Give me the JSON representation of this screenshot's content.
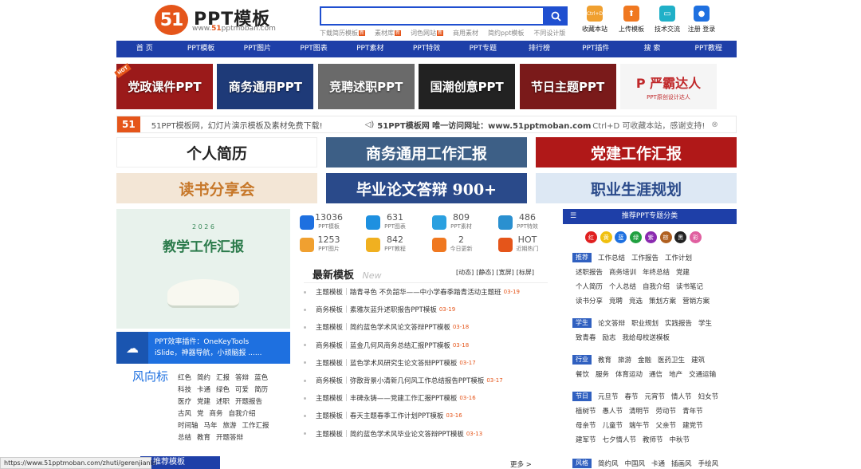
{
  "header": {
    "logo_mark": "51",
    "logo_text": "PPT模板",
    "logo_url_prefix": "www.",
    "logo_url_brand": "51",
    "logo_url_suffix": "pptmoban.com",
    "search_placeholder": "",
    "hot_links": [
      {
        "label": "下载简历模板",
        "badge": "新"
      },
      {
        "label": "素材库",
        "badge": "新"
      },
      {
        "label": "词色网站",
        "badge": "新"
      },
      {
        "label": "商用素材",
        "badge": ""
      },
      {
        "label": "简约ppt模板",
        "badge": ""
      },
      {
        "label": "不同设计版",
        "badge": ""
      }
    ],
    "tools": [
      {
        "label": "收藏本站",
        "icon": "ctrl-d-icon",
        "glyph": "Ctrl+D",
        "color": "#f0a030"
      },
      {
        "label": "上传模板",
        "icon": "upload-icon",
        "glyph": "⬆",
        "color": "#f07820"
      },
      {
        "label": "技术交流",
        "icon": "chat-icon",
        "glyph": "▭",
        "color": "#20b0c8"
      },
      {
        "label": "注册 登录",
        "icon": "user-icon",
        "glyph": "●",
        "color": "#1e70e0"
      }
    ]
  },
  "nav": [
    "首 页",
    "PPT模板",
    "PPT图片",
    "PPT图表",
    "PPT素材",
    "PPT特效",
    "PPT专题",
    "排行榜",
    "PPT插件",
    "搜 索",
    "PPT教程"
  ],
  "banners": [
    {
      "label": "党政课件PPT",
      "color": "#9b1a1a",
      "badge": "HOT"
    },
    {
      "label": "商务通用PPT",
      "color": "#1e3a78"
    },
    {
      "label": "竞聘述职PPT",
      "color": "#6a6a6a"
    },
    {
      "label": "国潮创意PPT",
      "color": "#222222"
    },
    {
      "label": "节日主题PPT",
      "color": "#7a1a1a"
    },
    {
      "label": "P 严霸达人",
      "sub": "PPT原创设计达人",
      "color": "#f5f5f5"
    }
  ],
  "notice": {
    "logo": "51",
    "left": "51PPT模板网，幻灯片演示模板及素材免费下载!",
    "center": "51PPT模板网 唯一访问网址：www.51pptmoban.com",
    "right": "Ctrl+D 可收藏本站，感谢支持!"
  },
  "feature_banners": [
    {
      "label": "个人简历",
      "color": "#ffffff",
      "text_color": "#222222"
    },
    {
      "label": "商务通用工作汇报",
      "color": "#3d5f86",
      "text_color": "#ffffff"
    },
    {
      "label": "党建工作汇报",
      "color": "#b01818",
      "text_color": "#ffffff"
    },
    {
      "label": "读书分享会",
      "color": "#f3e6d6",
      "text_color": "#c7782a"
    },
    {
      "label": "毕业论文答辩 900+",
      "color": "#2a4a8a",
      "text_color": "#ffffff"
    },
    {
      "label": "职业生涯规划",
      "color": "#dde8f4",
      "text_color": "#2a4a8a"
    }
  ],
  "promo": {
    "year": "2 0 2 6",
    "title": "教学工作汇报",
    "plugin_line1": "PPT效率插件：OneKeyTools",
    "plugin_line2": "iSlide，神器导航，小顽脑报 ......"
  },
  "stats": [
    {
      "value": "13036",
      "label": "PPT模板",
      "color": "#1e70e0"
    },
    {
      "value": "631",
      "label": "PPT图表",
      "color": "#1e90e0"
    },
    {
      "value": "809",
      "label": "PPT素材",
      "color": "#2aa0e0"
    },
    {
      "value": "486",
      "label": "PPT特效",
      "color": "#2a90d0"
    },
    {
      "value": "1253",
      "label": "PPT图片",
      "color": "#f0a030"
    },
    {
      "value": "842",
      "label": "PPT教程",
      "color": "#f0b020"
    },
    {
      "value": "2",
      "label": "今日更新",
      "color": "#f07820"
    },
    {
      "value": "HOT",
      "label": "近期热门",
      "color": "#e5551a"
    }
  ],
  "latest": {
    "title": "最新模板",
    "title_en": "New",
    "filters": [
      "[动态]",
      "[静态]",
      "[宽屏]",
      "[标屏]"
    ],
    "items": [
      {
        "tag": "主题模板",
        "title": "踏青寻色 不负韶华——中小学春季踏青活动主题班",
        "date": "03-19"
      },
      {
        "tag": "商务模板",
        "title": "素雅灰蓝升述职报告PPT模板",
        "date": "03-19"
      },
      {
        "tag": "主题模板",
        "title": "简约蓝色学术风论文答辩PPT模板",
        "date": "03-18"
      },
      {
        "tag": "商务模板",
        "title": "蓝金几何风商务总结汇报PPT模板",
        "date": "03-18"
      },
      {
        "tag": "主题模板",
        "title": "蓝色学术风研究生论文答辩PPT模板",
        "date": "03-17"
      },
      {
        "tag": "商务模板",
        "title": "弥散背景小清新几何风工作总结报告PPT模板",
        "date": "03-17"
      },
      {
        "tag": "主题模板",
        "title": "丰碑永铸——党建工作汇报PPT模板",
        "date": "03-16"
      },
      {
        "tag": "主题模板",
        "title": "春天主题春季工作计划PPT模板",
        "date": "03-16"
      },
      {
        "tag": "主题模板",
        "title": "简约蓝色学术风毕业论文答辩PPT模板",
        "date": "03-13"
      }
    ]
  },
  "recommend": {
    "title": "推荐PPT专题分类",
    "colors": [
      {
        "label": "红",
        "color": "#e02020"
      },
      {
        "label": "黄",
        "color": "#f0c010"
      },
      {
        "label": "蓝",
        "color": "#1e70e0"
      },
      {
        "label": "绿",
        "color": "#20a040"
      },
      {
        "label": "紫",
        "color": "#8a2ab0"
      },
      {
        "label": "棕",
        "color": "#b06020"
      },
      {
        "label": "黑",
        "color": "#222222"
      },
      {
        "label": "彩",
        "color": "#e060a0"
      }
    ],
    "rows": [
      {
        "tag": "推荐",
        "items": [
          "工作总结",
          "工作报告",
          "工作计划"
        ]
      },
      {
        "tag": "",
        "items": [
          "述职报告",
          "商务培训",
          "年终总结",
          "党建"
        ]
      },
      {
        "tag": "",
        "items": [
          "个人简历",
          "个人总结",
          "自我介绍",
          "读书笔记"
        ]
      },
      {
        "tag": "",
        "items": [
          "读书分享",
          "竞聘",
          "竞选",
          "策划方案",
          "营销方案"
        ]
      },
      {
        "tag": "学生",
        "items": [
          "论文答辩",
          "职业规划",
          "实践报告",
          "学生"
        ]
      },
      {
        "tag": "",
        "items": [
          "致青春",
          "励志",
          "我给母校送模板"
        ]
      },
      {
        "tag": "行业",
        "items": [
          "教育",
          "旅游",
          "金融",
          "医药卫生",
          "建筑"
        ]
      },
      {
        "tag": "",
        "items": [
          "餐饮",
          "服务",
          "体育运动",
          "通信",
          "地产",
          "交通运输"
        ]
      },
      {
        "tag": "节日",
        "items": [
          "元旦节",
          "春节",
          "元宵节",
          "情人节",
          "妇女节"
        ]
      },
      {
        "tag": "",
        "items": [
          "植树节",
          "愚人节",
          "清明节",
          "劳动节",
          "青年节"
        ]
      },
      {
        "tag": "",
        "items": [
          "母亲节",
          "儿童节",
          "端午节",
          "父亲节",
          "建党节"
        ]
      },
      {
        "tag": "",
        "items": [
          "建军节",
          "七夕情人节",
          "教师节",
          "中秋节"
        ]
      },
      {
        "tag": "风格",
        "items": [
          "简约风",
          "中国风",
          "卡通",
          "插画风",
          "手绘风"
        ]
      }
    ]
  },
  "style_tags": {
    "title": "风向标",
    "items": [
      "红色",
      "简约",
      "汇报",
      "答辩",
      "蓝色",
      "科技",
      "卡通",
      "绿色",
      "可爱",
      "简历",
      "医疗",
      "党建",
      "述职",
      "开题报告",
      "古风",
      "党",
      "商务",
      "自我介绍",
      "时间轴",
      "马年",
      "旅游",
      "工作汇报",
      "总结",
      "教育",
      "开题答辩"
    ]
  },
  "bottom": {
    "recommend_label": "推荐模板",
    "more": "更多 >",
    "status_url": "https://www.51pptmoban.com/zhuti/gerenjianli/"
  }
}
